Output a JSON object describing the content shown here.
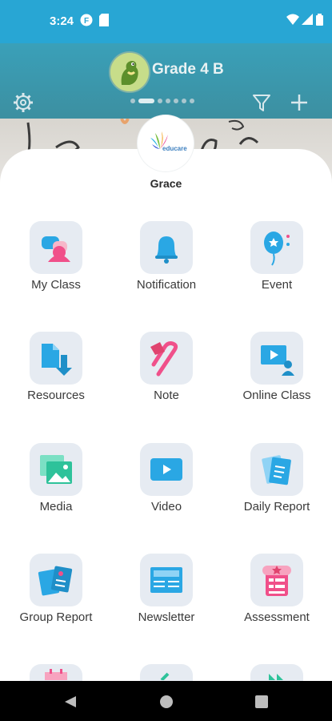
{
  "status": {
    "time": "3:24"
  },
  "header": {
    "title": "Grade 4 B"
  },
  "profile": {
    "name": "Grace",
    "logo_text": "educare"
  },
  "grid": [
    {
      "label": "My Class",
      "icon": "my-class-icon"
    },
    {
      "label": "Notification",
      "icon": "bell-icon"
    },
    {
      "label": "Event",
      "icon": "balloon-icon"
    },
    {
      "label": "Resources",
      "icon": "resources-icon"
    },
    {
      "label": "Note",
      "icon": "paperclip-icon"
    },
    {
      "label": "Online Class",
      "icon": "online-class-icon"
    },
    {
      "label": "Media",
      "icon": "media-icon"
    },
    {
      "label": "Video",
      "icon": "video-icon"
    },
    {
      "label": "Daily Report",
      "icon": "daily-report-icon"
    },
    {
      "label": "Group Report",
      "icon": "group-report-icon"
    },
    {
      "label": "Newsletter",
      "icon": "newsletter-icon"
    },
    {
      "label": "Assessment",
      "icon": "assessment-icon"
    }
  ],
  "colors": {
    "accent": "#29a6d3",
    "tile_bg": "#e6ebf2",
    "pink": "#f0508a",
    "blue": "#2aa7e4"
  }
}
